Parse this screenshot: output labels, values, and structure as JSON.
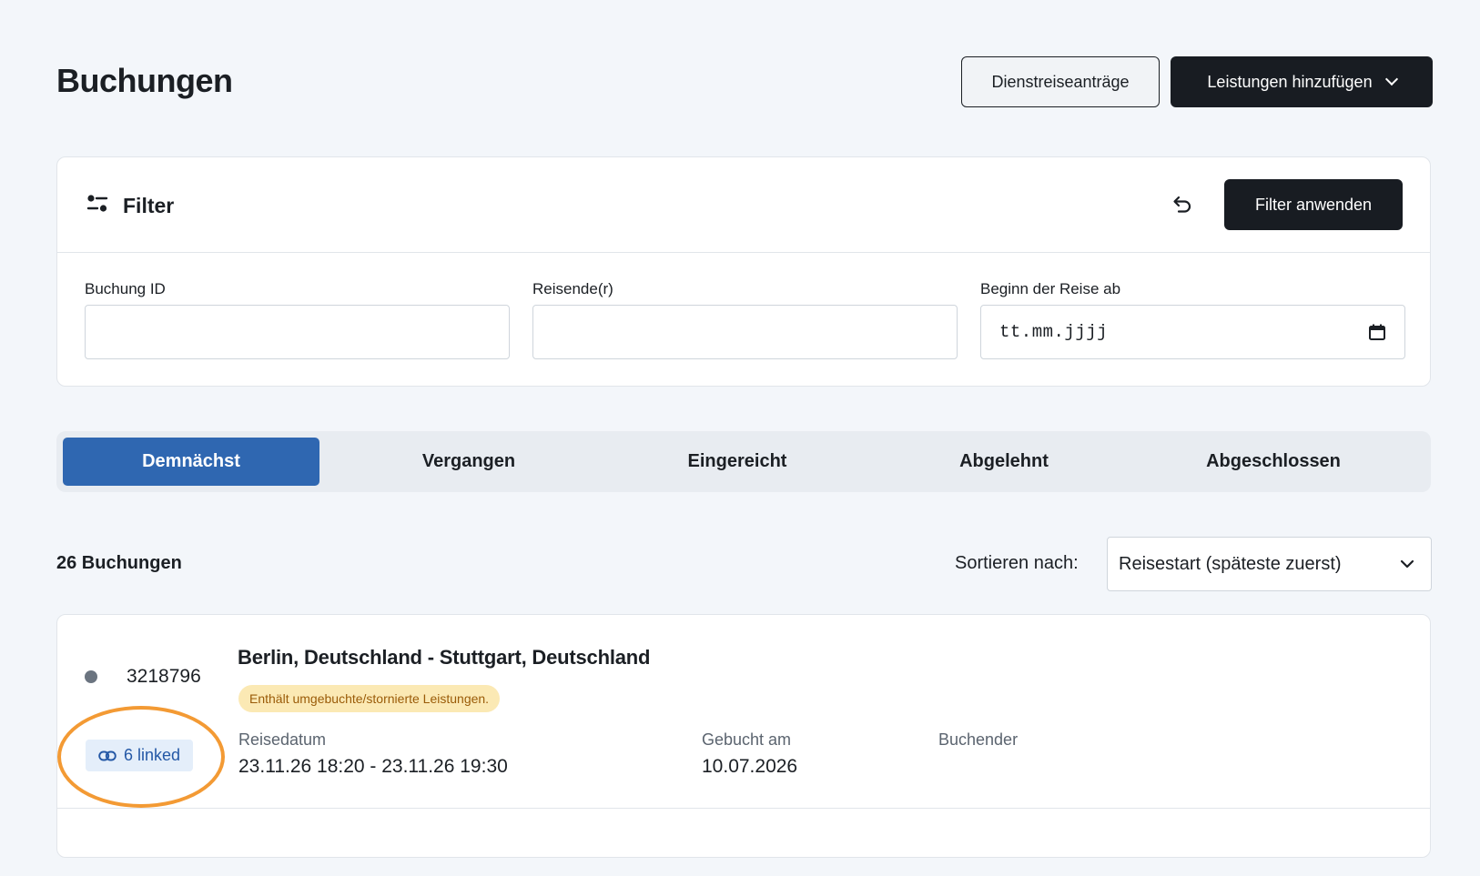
{
  "header": {
    "title": "Buchungen",
    "requests_button": "Dienstreiseanträge",
    "add_button": "Leistungen hinzufügen"
  },
  "filter": {
    "title": "Filter",
    "apply_button": "Filter anwenden",
    "fields": {
      "booking_id": {
        "label": "Buchung ID",
        "value": "",
        "placeholder": ""
      },
      "traveler": {
        "label": "Reisende(r)",
        "value": "",
        "placeholder": ""
      },
      "start_date": {
        "label": "Beginn der Reise ab",
        "placeholder": "tt.mm.jjjj"
      }
    }
  },
  "tabs": [
    {
      "label": "Demnächst",
      "active": true
    },
    {
      "label": "Vergangen",
      "active": false
    },
    {
      "label": "Eingereicht",
      "active": false
    },
    {
      "label": "Abgelehnt",
      "active": false
    },
    {
      "label": "Abgeschlossen",
      "active": false
    }
  ],
  "results": {
    "count_label": "26 Buchungen",
    "sort_label": "Sortieren nach:",
    "sort_value": "Reisestart (späteste zuerst)"
  },
  "booking": {
    "id": "3218796",
    "status_color": "#6b7480",
    "linked_label": "6 linked",
    "route": "Berlin, Deutschland - Stuttgart, Deutschland",
    "warning": "Enthält umgebuchte/stornierte Leistungen.",
    "travel_date_label": "Reisedatum",
    "travel_date_value": "23.11.26 18:20 - 23.11.26 19:30",
    "booked_label": "Gebucht am",
    "booked_value": "10.07.2026",
    "booker_label": "Buchender",
    "booker_value": ""
  },
  "colors": {
    "accent": "#2f67b1",
    "dark_button": "#181c22",
    "highlight": "#f39a34",
    "warning_bg": "#fbe9b4"
  },
  "icons": {
    "filter": "filter-sliders-icon",
    "reset": "undo-icon",
    "calendar": "calendar-icon",
    "link": "link-icon",
    "dropdown": "chevron-down-icon"
  }
}
